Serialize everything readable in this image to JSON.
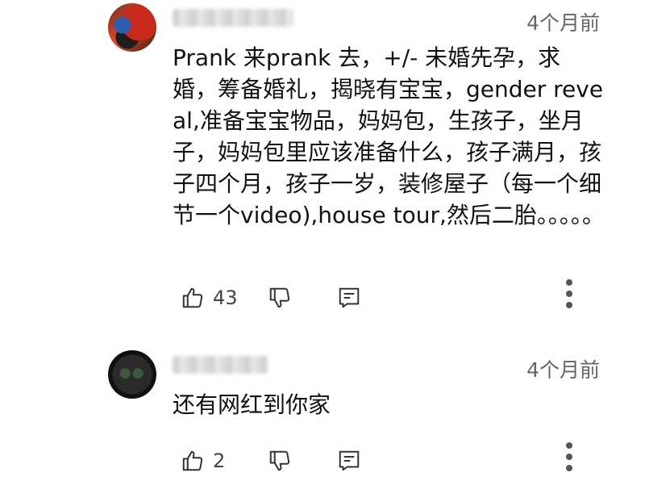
{
  "comments": [
    {
      "time": "4个月前",
      "text": "Prank 来prank 去，+/- 未婚先孕，求婚，筹备婚礼，揭晓有宝宝，gender reveal,准备宝宝物品，妈妈包，生孩子，坐月子，妈妈包里应该准备什么，孩子满月，孩子四个月，孩子一岁，装修屋子（每一个细节一个video),house tour,然后二胎。。。。。",
      "likes": "43"
    },
    {
      "time": "4个月前",
      "text": "还有网红到你家",
      "likes": "2"
    }
  ],
  "icons": {
    "like": "thumbs-up-icon",
    "dislike": "thumbs-down-icon",
    "reply": "reply-icon",
    "more": "more-vert-icon"
  }
}
